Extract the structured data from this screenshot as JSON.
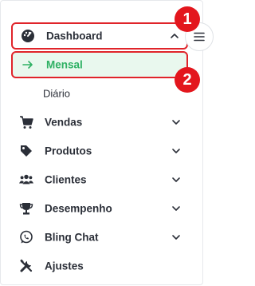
{
  "menu": {
    "dashboard": "Dashboard",
    "mensal": "Mensal",
    "diario": "Diário",
    "vendas": "Vendas",
    "produtos": "Produtos",
    "clientes": "Clientes",
    "desempenho": "Desempenho",
    "bling_chat": "Bling Chat",
    "ajustes": "Ajustes"
  },
  "badges": {
    "one": "1",
    "two": "2"
  },
  "colors": {
    "accent": "#2fb164",
    "highlight": "#e0242a",
    "badge": "#e3161d"
  }
}
